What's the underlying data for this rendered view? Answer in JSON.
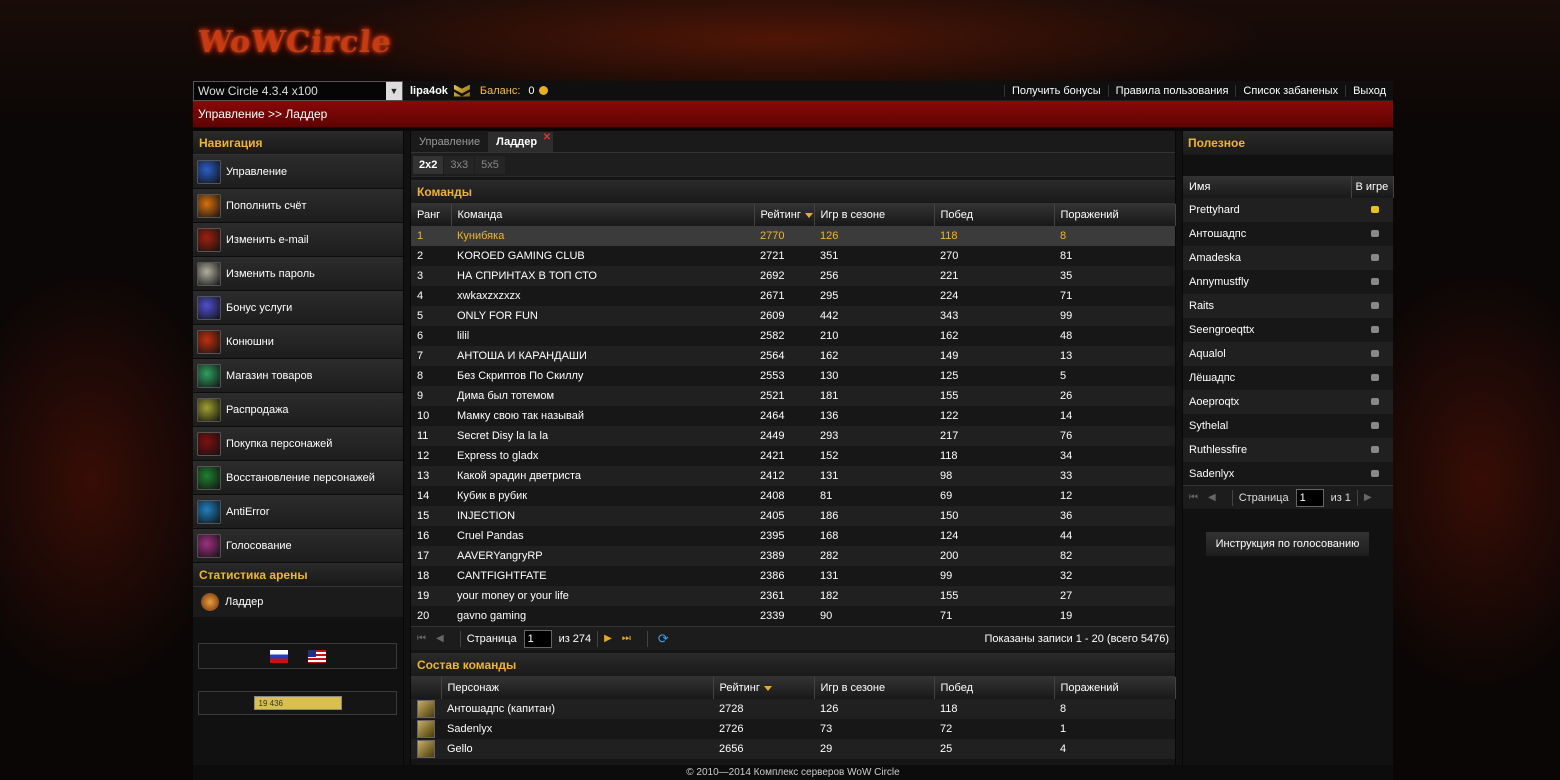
{
  "logo": "WoWCircle",
  "topbar": {
    "server": "Wow Circle 4.3.4 x100",
    "user": "lipa4ok",
    "balance_label": "Баланс:",
    "balance_value": "0",
    "links": [
      "Получить бонусы",
      "Правила пользования",
      "Список забаненых",
      "Выход"
    ]
  },
  "breadcrumb": "Управление >> Ладдер",
  "nav": {
    "title": "Навигация",
    "items": [
      {
        "label": "Управление",
        "icon": "control-icon",
        "color": "#2a5ec8"
      },
      {
        "label": "Пополнить счёт",
        "icon": "coins-icon",
        "color": "#d87010"
      },
      {
        "label": "Изменить e-mail",
        "icon": "email-icon",
        "color": "#a02010"
      },
      {
        "label": "Изменить пароль",
        "icon": "key-icon",
        "color": "#b0b0a0"
      },
      {
        "label": "Бонус услуги",
        "icon": "bonus-icon",
        "color": "#5050d0"
      },
      {
        "label": "Конюшни",
        "icon": "stable-icon",
        "color": "#c03010"
      },
      {
        "label": "Магазин товаров",
        "icon": "shop-icon",
        "color": "#30a060"
      },
      {
        "label": "Распродажа",
        "icon": "sale-icon",
        "color": "#a0a030"
      },
      {
        "label": "Покупка персонажей",
        "icon": "buy-character-icon",
        "color": "#801010"
      },
      {
        "label": "Восстановление персонажей",
        "icon": "restore-character-icon",
        "color": "#208030"
      },
      {
        "label": "AntiError",
        "icon": "antierror-icon",
        "color": "#2080c0"
      },
      {
        "label": "Голосование",
        "icon": "vote-icon",
        "color": "#a03080"
      }
    ],
    "arena_title": "Статистика арены",
    "ladder": "Ладдер",
    "counter": "19 436"
  },
  "tabs": [
    "Управление",
    "Ладдер"
  ],
  "subtabs": [
    "2x2",
    "3x3",
    "5x5"
  ],
  "teams": {
    "title": "Команды",
    "columns": [
      "Ранг",
      "Команда",
      "Рейтинг",
      "Игр в сезоне",
      "Побед",
      "Поражений"
    ],
    "rows": [
      [
        "1",
        "Кунибяка",
        "2770",
        "126",
        "118",
        "8"
      ],
      [
        "2",
        "KOROED GAMING CLUB",
        "2721",
        "351",
        "270",
        "81"
      ],
      [
        "3",
        "НА СПРИНТАХ В ТОП СТО",
        "2692",
        "256",
        "221",
        "35"
      ],
      [
        "4",
        "xwkaxzxzxzx",
        "2671",
        "295",
        "224",
        "71"
      ],
      [
        "5",
        "ONLY FOR FUN",
        "2609",
        "442",
        "343",
        "99"
      ],
      [
        "6",
        "lilil",
        "2582",
        "210",
        "162",
        "48"
      ],
      [
        "7",
        "АНТОША И КАРАНДАШИ",
        "2564",
        "162",
        "149",
        "13"
      ],
      [
        "8",
        "Без Скриптов По Скиллу",
        "2553",
        "130",
        "125",
        "5"
      ],
      [
        "9",
        "Дима был тотемом",
        "2521",
        "181",
        "155",
        "26"
      ],
      [
        "10",
        "Мамку свою так называй",
        "2464",
        "136",
        "122",
        "14"
      ],
      [
        "11",
        "Secret Disy la la la",
        "2449",
        "293",
        "217",
        "76"
      ],
      [
        "12",
        "Express to gladx",
        "2421",
        "152",
        "118",
        "34"
      ],
      [
        "13",
        "Какой эрадин дветриста",
        "2412",
        "131",
        "98",
        "33"
      ],
      [
        "14",
        "Кубик в рубик",
        "2408",
        "81",
        "69",
        "12"
      ],
      [
        "15",
        "INJECTION",
        "2405",
        "186",
        "150",
        "36"
      ],
      [
        "16",
        "Cruel Pandas",
        "2395",
        "168",
        "124",
        "44"
      ],
      [
        "17",
        "AAVERYangryRP",
        "2389",
        "282",
        "200",
        "82"
      ],
      [
        "18",
        "CANTFIGHTFATE",
        "2386",
        "131",
        "99",
        "32"
      ],
      [
        "19",
        "your money or your life",
        "2361",
        "182",
        "155",
        "27"
      ],
      [
        "20",
        "gavno gaming",
        "2339",
        "90",
        "71",
        "19"
      ]
    ],
    "pager": {
      "label": "Страница",
      "page": "1",
      "of": "из 274",
      "info": "Показаны записи 1 - 20 (всего 5476)"
    }
  },
  "roster": {
    "title": "Состав команды",
    "columns": [
      "Персонаж",
      "Рейтинг",
      "Игр в сезоне",
      "Побед",
      "Поражений"
    ],
    "rows": [
      [
        "Антошадпс (капитан)",
        "2728",
        "126",
        "118",
        "8"
      ],
      [
        "Sadenlyx",
        "2726",
        "73",
        "72",
        "1"
      ],
      [
        "Gello",
        "2656",
        "29",
        "25",
        "4"
      ]
    ]
  },
  "useful": {
    "title": "Полезное",
    "columns": [
      "Имя",
      "В игре"
    ],
    "rows": [
      {
        "name": "Prettyhard",
        "online": true
      },
      {
        "name": "Антошадпс",
        "online": false
      },
      {
        "name": "Amadeska",
        "online": false
      },
      {
        "name": "Annymustfly",
        "online": false
      },
      {
        "name": "Raits",
        "online": false
      },
      {
        "name": "Seengroeqttx",
        "online": false
      },
      {
        "name": "Aqualol",
        "online": false
      },
      {
        "name": "Лёшадпс",
        "online": false
      },
      {
        "name": "Aoeproqtx",
        "online": false
      },
      {
        "name": "Sythelal",
        "online": false
      },
      {
        "name": "Ruthlessfire",
        "online": false
      },
      {
        "name": "Sadenlyx",
        "online": false
      }
    ],
    "pager": {
      "label": "Страница",
      "page": "1",
      "of": "из 1"
    },
    "vote_button": "Инструкция по голосованию"
  },
  "footer": "© 2010—2014 Комплекс серверов WoW Circle"
}
